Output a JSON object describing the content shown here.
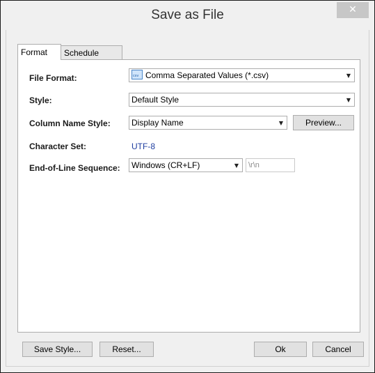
{
  "window": {
    "title": "Save as File",
    "close_glyph": "✕"
  },
  "tabs": [
    {
      "label": "Format",
      "active": true
    },
    {
      "label": "Schedule",
      "active": false
    }
  ],
  "form": {
    "file_format": {
      "label": "File Format:",
      "value": "Comma Separated Values (*.csv)",
      "icon": "csv-file-icon",
      "icon_text": "csv"
    },
    "style": {
      "label": "Style:",
      "value": "Default Style"
    },
    "column_name_style": {
      "label": "Column Name Style:",
      "value": "Display Name",
      "preview_label": "Preview..."
    },
    "character_set": {
      "label": "Character Set:",
      "value": "UTF-8"
    },
    "eol": {
      "label": "End-of-Line Sequence:",
      "value": "Windows (CR+LF)",
      "text_value": "\\r\\n"
    }
  },
  "footer": {
    "save_style_label": "Save Style...",
    "reset_label": "Reset...",
    "ok_label": "Ok",
    "cancel_label": "Cancel"
  }
}
